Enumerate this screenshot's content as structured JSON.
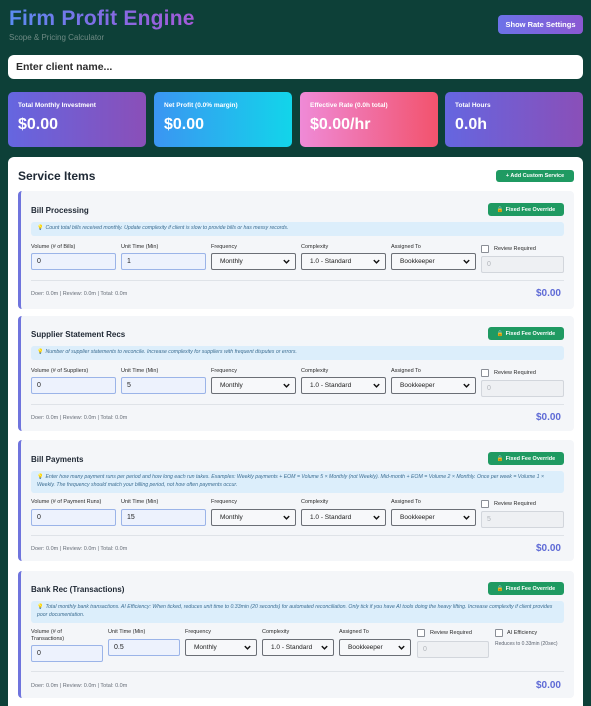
{
  "header": {
    "title": "Firm Profit Engine",
    "subtitle": "Scope & Pricing Calculator",
    "rate_button": "Show Rate Settings"
  },
  "client": {
    "placeholder": "Enter client name..."
  },
  "stats": [
    {
      "label": "Total Monthly Investment",
      "value": "$0.00"
    },
    {
      "label": "Net Profit (0.0% margin)",
      "value": "$0.00"
    },
    {
      "label": "Effective Rate (0.0h total)",
      "value": "$0.00/hr"
    },
    {
      "label": "Total Hours",
      "value": "0.0h"
    }
  ],
  "panel": {
    "title": "Service Items",
    "add_button": "+ Add Custom Service"
  },
  "common": {
    "fee_button": "Fixed Fee Override",
    "unit_label": "Unit Time (Min)",
    "freq_label": "Frequency",
    "complexity_label": "Complexity",
    "assigned_label": "Assigned To",
    "review_label": "Review Required",
    "ai_label": "AI Efficiency",
    "ai_note": "Reduces to 0.33min (20sec)"
  },
  "services": [
    {
      "title": "Bill Processing",
      "hint": "Count total bills received monthly. Update complexity if client is slow to provide bills or has messy records.",
      "volume_label": "Volume (# of Bills)",
      "volume": "0",
      "unit": "1",
      "frequency": "Monthly",
      "complexity": "1.0 - Standard",
      "assigned": "Bookkeeper",
      "review": "0",
      "metrics": "Doer: 0.0m | Review: 0.0m | Total: 0.0m",
      "total": "$0.00"
    },
    {
      "title": "Supplier Statement Recs",
      "hint": "Number of supplier statements to reconcile. Increase complexity for suppliers with frequent disputes or errors.",
      "volume_label": "Volume (# of Suppliers)",
      "volume": "0",
      "unit": "5",
      "frequency": "Monthly",
      "complexity": "1.0 - Standard",
      "assigned": "Bookkeeper",
      "review": "0",
      "metrics": "Doer: 0.0m | Review: 0.0m | Total: 0.0m",
      "total": "$0.00"
    },
    {
      "title": "Bill Payments",
      "hint": "Enter how many payment runs per period and how long each run takes. Examples: Weekly payments + EOM = Volume 5 × Monthly (not Weekly). Mid-month + EOM = Volume 2 × Monthly. Once per week = Volume 1 × Weekly. The frequency should match your billing period, not how often payments occur.",
      "volume_label": "Volume (# of Payment Runs)",
      "volume": "0",
      "unit": "15",
      "frequency": "Monthly",
      "complexity": "1.0 - Standard",
      "assigned": "Bookkeeper",
      "review": "5",
      "metrics": "Doer: 0.0m | Review: 0.0m | Total: 0.0m",
      "total": "$0.00"
    },
    {
      "title": "Bank Rec (Transactions)",
      "hint": "Total monthly bank transactions. AI Efficiency: When ticked, reduces unit time to 0.33min (20 seconds) for automated reconciliation. Only tick if you have AI tools doing the heavy lifting. Increase complexity if client provides poor documentation.",
      "volume_label": "Volume (# of Transactions)",
      "volume": "0",
      "unit": "0.5",
      "frequency": "Monthly",
      "complexity": "1.0 - Standard",
      "assigned": "Bookkeeper",
      "review": "0",
      "metrics": "Doer: 0.0m | Review: 0.0m | Total: 0.0m",
      "total": "$0.00"
    }
  ]
}
